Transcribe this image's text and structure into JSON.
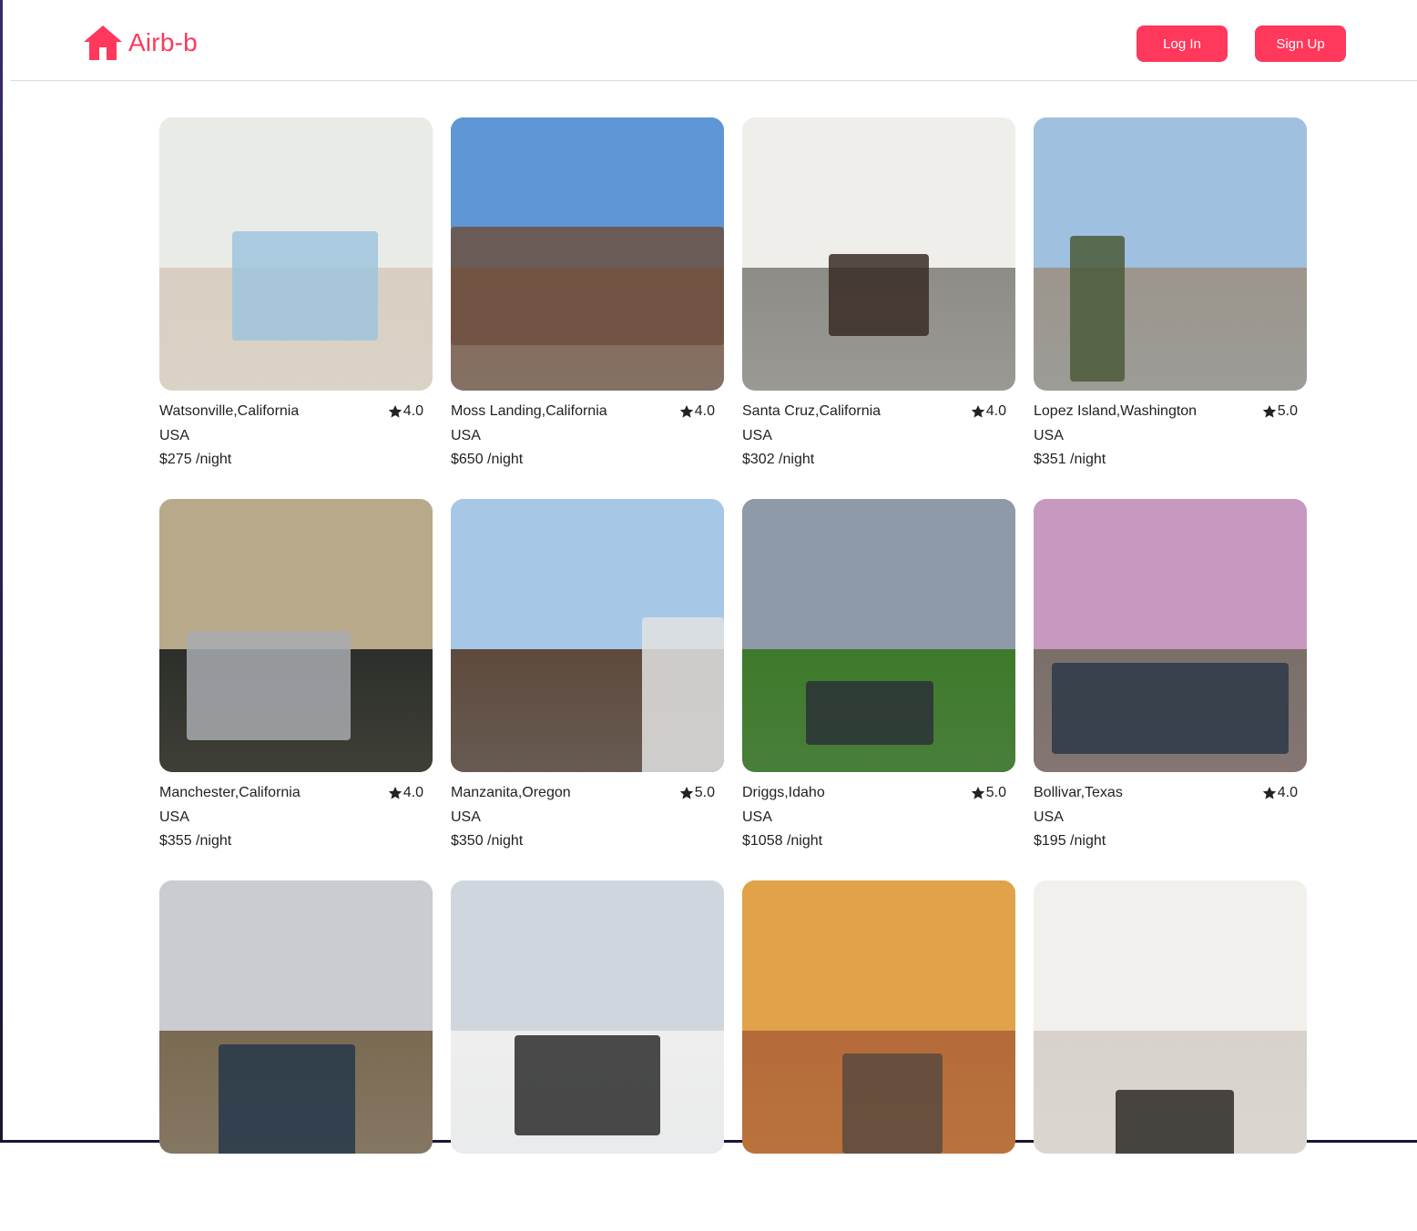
{
  "brand": {
    "name": "Airb-b",
    "color": "#ff385c",
    "icon": "house-icon"
  },
  "nav": {
    "login_label": "Log In",
    "signup_label": "Sign Up"
  },
  "listings": [
    {
      "location": "Watsonville,California",
      "country": "USA",
      "rating": "4.0",
      "price": "$275 /night",
      "photo": {
        "sky": "#e9ebe6",
        "ground": "#d8cfc2",
        "accent": "#9fc4dd"
      }
    },
    {
      "location": "Moss Landing,California",
      "country": "USA",
      "rating": "4.0",
      "price": "$650 /night",
      "photo": {
        "sky": "#5f97d6",
        "ground": "#8a6a54",
        "accent": "#6d5040"
      }
    },
    {
      "location": "Santa Cruz,California",
      "country": "USA",
      "rating": "4.0",
      "price": "$302 /night",
      "photo": {
        "sky": "#f0eeea",
        "ground": "#8d8c87",
        "accent": "#3a2d25"
      }
    },
    {
      "location": "Lopez Island,Washington",
      "country": "USA",
      "rating": "5.0",
      "price": "$351 /night",
      "photo": {
        "sky": "#9fc0df",
        "ground": "#9c968c",
        "accent": "#4b5a3a"
      }
    },
    {
      "location": "Manchester,California",
      "country": "USA",
      "rating": "4.0",
      "price": "$355 /night",
      "photo": {
        "sky": "#b8a98a",
        "ground": "#2c2f2a",
        "accent": "#a8acb0"
      }
    },
    {
      "location": "Manzanita,Oregon",
      "country": "USA",
      "rating": "5.0",
      "price": "$350 /night",
      "photo": {
        "sky": "#a7c7e6",
        "ground": "#5e4a3c",
        "accent": "#e2e2e0"
      }
    },
    {
      "location": "Driggs,Idaho",
      "country": "USA",
      "rating": "5.0",
      "price": "$1058 /night",
      "photo": {
        "sky": "#8e9aa8",
        "ground": "#3e7a2a",
        "accent": "#2c3137"
      }
    },
    {
      "location": "Bollivar,Texas",
      "country": "USA",
      "rating": "4.0",
      "price": "$195 /night",
      "photo": {
        "sky": "#c798c0",
        "ground": "#7a7068",
        "accent": "#2d3848"
      }
    },
    {
      "location": "",
      "country": "",
      "rating": "",
      "price": "",
      "photo": {
        "sky": "#c9ccd0",
        "ground": "#7a6a52",
        "accent": "#24384a"
      }
    },
    {
      "location": "",
      "country": "",
      "rating": "",
      "price": "",
      "photo": {
        "sky": "#cfd6de",
        "ground": "#eeeeee",
        "accent": "#2b2b2b"
      }
    },
    {
      "location": "",
      "country": "",
      "rating": "",
      "price": "",
      "photo": {
        "sky": "#e0a34a",
        "ground": "#b46b3a",
        "accent": "#5b4a3e"
      }
    },
    {
      "location": "",
      "country": "",
      "rating": "",
      "price": "",
      "photo": {
        "sky": "#f2f0ec",
        "ground": "#d7d2cb",
        "accent": "#2d2a26"
      }
    }
  ]
}
